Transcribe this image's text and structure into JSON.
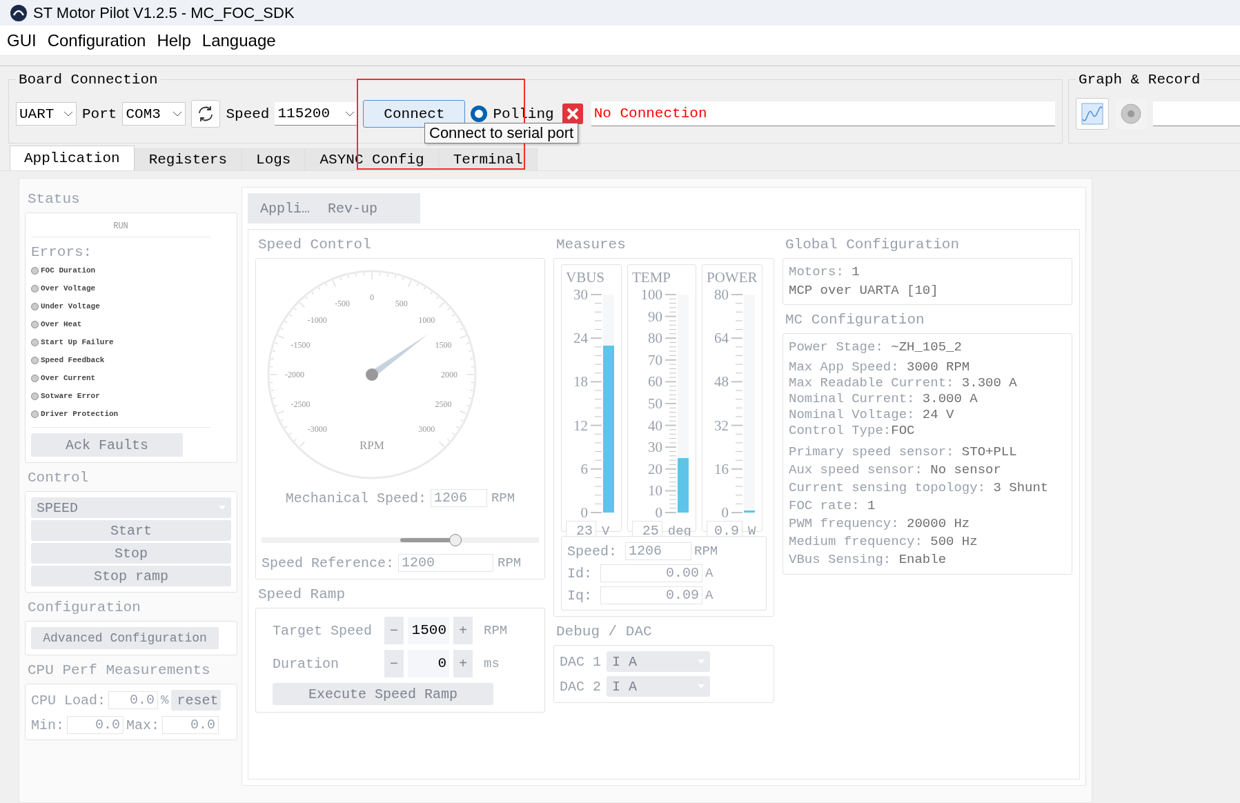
{
  "window": {
    "title": "ST Motor Pilot V1.2.5 - MC_FOC_SDK"
  },
  "menu": [
    "GUI",
    "Configuration",
    "Help",
    "Language"
  ],
  "board_connection": {
    "title": "Board Connection",
    "interface": "UART",
    "port_label": "Port",
    "port": "COM3",
    "speed_label": "Speed",
    "speed": "115200",
    "connect_button": "Connect",
    "polling": {
      "label": "Polling",
      "selected": true
    },
    "connected": false,
    "status": "No Connection"
  },
  "graph_record": {
    "title": "Graph & Record"
  },
  "tooltip": "Connect to serial port",
  "tabs": [
    {
      "label": "Application",
      "selected": true
    },
    {
      "label": "Registers",
      "selected": false
    },
    {
      "label": "Logs",
      "selected": false
    },
    {
      "label": "ASYNC Config",
      "selected": false
    },
    {
      "label": "Terminal",
      "selected": false
    }
  ],
  "application": {
    "disabled": true,
    "status": {
      "title": "Status",
      "state": "RUN",
      "errors_label": "Errors:",
      "errors": [
        {
          "label": "FOC Duration",
          "active": false
        },
        {
          "label": "Over Voltage",
          "active": false
        },
        {
          "label": "Under Voltage",
          "active": false
        },
        {
          "label": "Over Heat",
          "active": false
        },
        {
          "label": "Start Up Failure",
          "active": false
        },
        {
          "label": "Speed Feedback",
          "active": false
        },
        {
          "label": "Over Current",
          "active": false
        },
        {
          "label": "Sotware Error",
          "active": false
        },
        {
          "label": "Driver Protection",
          "active": false
        }
      ],
      "ack_button": "Ack Faults"
    },
    "control": {
      "title": "Control",
      "mode": "SPEED",
      "buttons": [
        "Start",
        "Stop",
        "Stop ramp"
      ]
    },
    "configuration": {
      "title": "Configuration",
      "button": "Advanced Configuration"
    },
    "cpu": {
      "title": "CPU Perf Measurements",
      "load_label": "CPU Load:",
      "load": "0.0",
      "load_unit": "%",
      "reset_button": "reset",
      "min_label": "Min:",
      "min": "0.0",
      "max_label": "Max:",
      "max": "0.0"
    },
    "subtabs": [
      "Appli…",
      "Rev-up"
    ],
    "speed_control": {
      "title": "Speed Control",
      "gauge": {
        "level": 0.701,
        "unit": "RPM",
        "ticks": [
          "-3000",
          "-2500",
          "-2000",
          "-1500",
          "-1000",
          "-500",
          "0",
          "500",
          "1000",
          "1500",
          "2000",
          "2500",
          "3000"
        ]
      },
      "mech_label": "Mechanical Speed:",
      "mech_value": "1206",
      "mech_unit": "RPM",
      "slider": {
        "level": 0.7
      },
      "ref_label": "Speed Reference:",
      "ref_value": "1200",
      "ref_unit": "RPM"
    },
    "speed_ramp": {
      "title": "Speed Ramp",
      "rows": [
        {
          "label": "Target Speed",
          "minus": "−",
          "value": "1500",
          "plus": "+",
          "unit": "RPM"
        },
        {
          "label": "Duration",
          "minus": "−",
          "value": "0",
          "plus": "+",
          "unit": "ms"
        }
      ],
      "execute_button": "Execute Speed Ramp"
    },
    "measures": {
      "title": "Measures",
      "meters": [
        {
          "name": "VBUS",
          "ticks": [
            "30",
            "24",
            "18",
            "12",
            "6",
            "0"
          ],
          "level": 0.767,
          "value": "23",
          "unit": "V"
        },
        {
          "name": "TEMP",
          "ticks": [
            "100",
            "90",
            "80",
            "70",
            "60",
            "50",
            "40",
            "30",
            "20",
            "10",
            "0"
          ],
          "level": 0.25,
          "value": "25",
          "unit": "deg"
        },
        {
          "name": "POWER",
          "ticks": [
            "80",
            "64",
            "48",
            "32",
            "16",
            "0"
          ],
          "level": 0.011,
          "value": "0.9",
          "unit": "W"
        }
      ],
      "readings": [
        {
          "label": "Speed:",
          "value": "1206",
          "unit": "RPM"
        },
        {
          "label": "Id:",
          "value": "0.00",
          "unit": "A"
        },
        {
          "label": "Iq:",
          "value": "0.09",
          "unit": "A"
        }
      ]
    },
    "dac": {
      "title": "Debug / DAC",
      "channels": [
        {
          "label": "DAC 1",
          "value": "I A"
        },
        {
          "label": "DAC 2",
          "value": "I A"
        }
      ]
    },
    "global_config": {
      "title": "Global Configuration",
      "lines": [
        {
          "label": "Motors: ",
          "value": "1"
        },
        {
          "value": "MCP over UARTA [10]"
        }
      ]
    },
    "mc_config": {
      "title": "MC Configuration",
      "groups": [
        [
          {
            "label": "Power Stage: ",
            "value": "~ZH_105_2"
          }
        ],
        [
          {
            "label": "Max App Speed: ",
            "value": "3000 RPM"
          },
          {
            "label": "Max Readable Current: ",
            "value": "3.300 A"
          },
          {
            "label": "Nominal Current: ",
            "value": "3.000 A"
          },
          {
            "label": "Nominal Voltage: ",
            "value": "24 V"
          },
          {
            "label": "Control Type:",
            "value": "FOC"
          }
        ],
        [
          {
            "label": "Primary speed sensor: ",
            "value": "STO+PLL"
          },
          {
            "label": "Aux speed sensor: ",
            "value": "No sensor"
          },
          {
            "label": "Current sensing topology: ",
            "value": "3 Shunt"
          },
          {
            "label": "FOC rate: ",
            "value": "1"
          },
          {
            "label": "PWM frequency: ",
            "value": "20000 Hz"
          },
          {
            "label": "Medium frequency: ",
            "value": "500 Hz"
          },
          {
            "label": "VBus Sensing: ",
            "value": "Enable"
          }
        ]
      ]
    }
  }
}
